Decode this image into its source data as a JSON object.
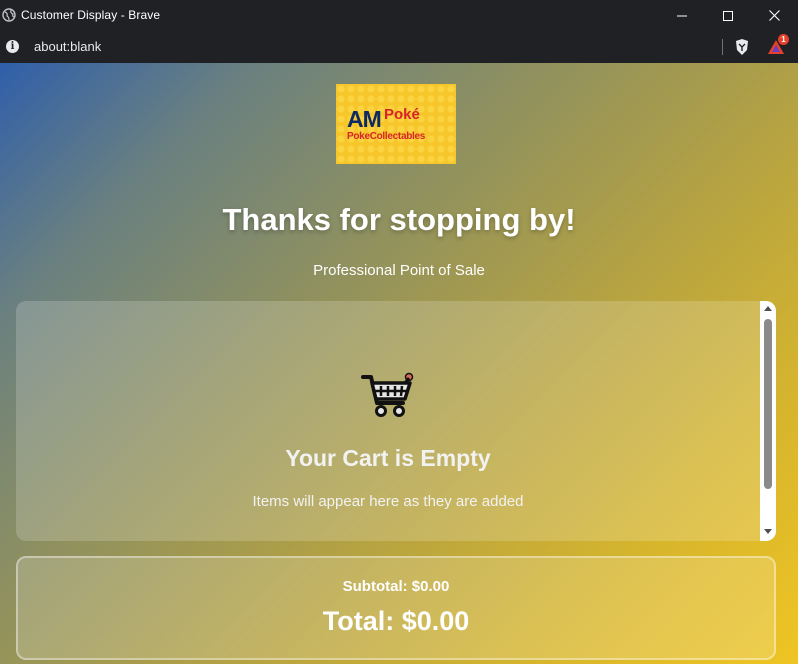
{
  "window": {
    "title": "Customer Display - Brave",
    "controls": {
      "minimize_icon": "minimize-icon",
      "maximize_icon": "maximize-icon",
      "close_icon": "close-icon"
    }
  },
  "address_bar": {
    "url": "about:blank",
    "rewards_badge": "1"
  },
  "logo": {
    "am": "AM",
    "poke": "Poké",
    "sub": "PokeCollectables"
  },
  "header": {
    "title": "Thanks for stopping by!",
    "subtitle": "Professional Point of Sale"
  },
  "cart": {
    "icon": "shopping-cart-icon",
    "empty_title": "Your Cart is Empty",
    "empty_subtitle": "Items will appear here as they are added"
  },
  "totals": {
    "subtotal": "Subtotal: $0.00",
    "total": "Total: $0.00"
  },
  "colors": {
    "gradient_start": "#2f5faa",
    "gradient_end": "#efc524",
    "logo_bg": "#f6c62b",
    "logo_navy": "#0e2a63",
    "logo_red": "#d8232a"
  }
}
